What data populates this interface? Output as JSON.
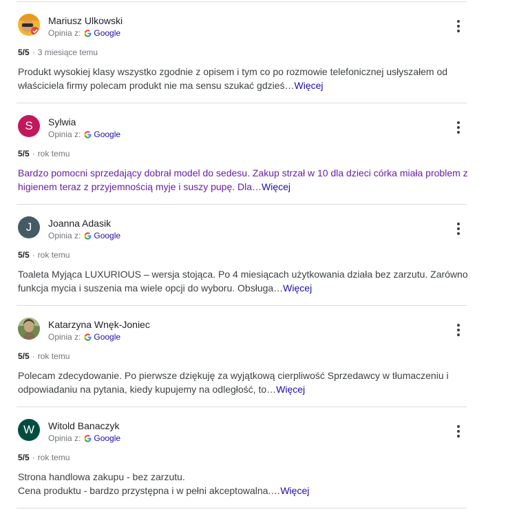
{
  "reviews": [
    {
      "name": "Mariusz Ulkowski",
      "source_prefix": "Opinia z:",
      "source_name": "Google",
      "rating": "5/5",
      "time": "3 miesiące temu",
      "text": "Produkt wysokiej klasy wszystko zgodnie z opisem i tym co po rozmowie telefonicznej usłyszałem od właściciela firmy polecam produkt nie ma sensu szukać gdzieś…",
      "more_label": "Więcej",
      "avatar": {
        "type": "photo",
        "icon": "user-photo-icon"
      }
    },
    {
      "name": "Sylwia",
      "source_prefix": "Opinia z:",
      "source_name": "Google",
      "rating": "5/5",
      "time": "rok temu",
      "text": "Bardzo pomocni sprzedający dobrał model do sedesu. Zakup strzał w 10 dla dzieci córka miała problem z higienem teraz z przyjemnością myje i suszy pupę. Dla…",
      "more_label": "Więcej",
      "avatar": {
        "type": "letter",
        "letter": "S",
        "color": "#c2185b"
      }
    },
    {
      "name": "Joanna Adasik",
      "source_prefix": "Opinia z:",
      "source_name": "Google",
      "rating": "5/5",
      "time": "rok temu",
      "text": "Toaleta Myjąca LUXURIOUS – wersja stojąca. Po 4 miesiącach użytkowania działa bez zarzutu. Zarówno funkcja mycia i suszenia ma wiele opcji do wyboru. Obsługa…",
      "more_label": "Więcej",
      "avatar": {
        "type": "letter",
        "letter": "J",
        "color": "#455a64"
      }
    },
    {
      "name": "Katarzyna Wnęk-Joniec",
      "source_prefix": "Opinia z:",
      "source_name": "Google",
      "rating": "5/5",
      "time": "rok temu",
      "text": "Polecam zdecydowanie. Po pierwsze dziękuję za wyjątkową cierpliwość Sprzedawcy w tłumaczeniu i odpowiadaniu na pytania, kiedy kupujemy na odległość, to…",
      "more_label": "Więcej",
      "avatar": {
        "type": "photo",
        "icon": "user-photo-icon"
      }
    },
    {
      "name": "Witold Banaczyk",
      "source_prefix": "Opinia z:",
      "source_name": "Google",
      "rating": "5/5",
      "time": "rok temu",
      "text_lines": [
        "Strona handlowa zakupu - bez zarzutu.",
        "Cena produktu - bardzo przystępna i w pełni akceptowalna.…"
      ],
      "more_label": "Więcej",
      "avatar": {
        "type": "letter",
        "letter": "W",
        "color": "#004d40"
      }
    }
  ],
  "colors": {
    "link": "#1a0dab",
    "visited": "#681da8",
    "divider": "#dadce0"
  }
}
